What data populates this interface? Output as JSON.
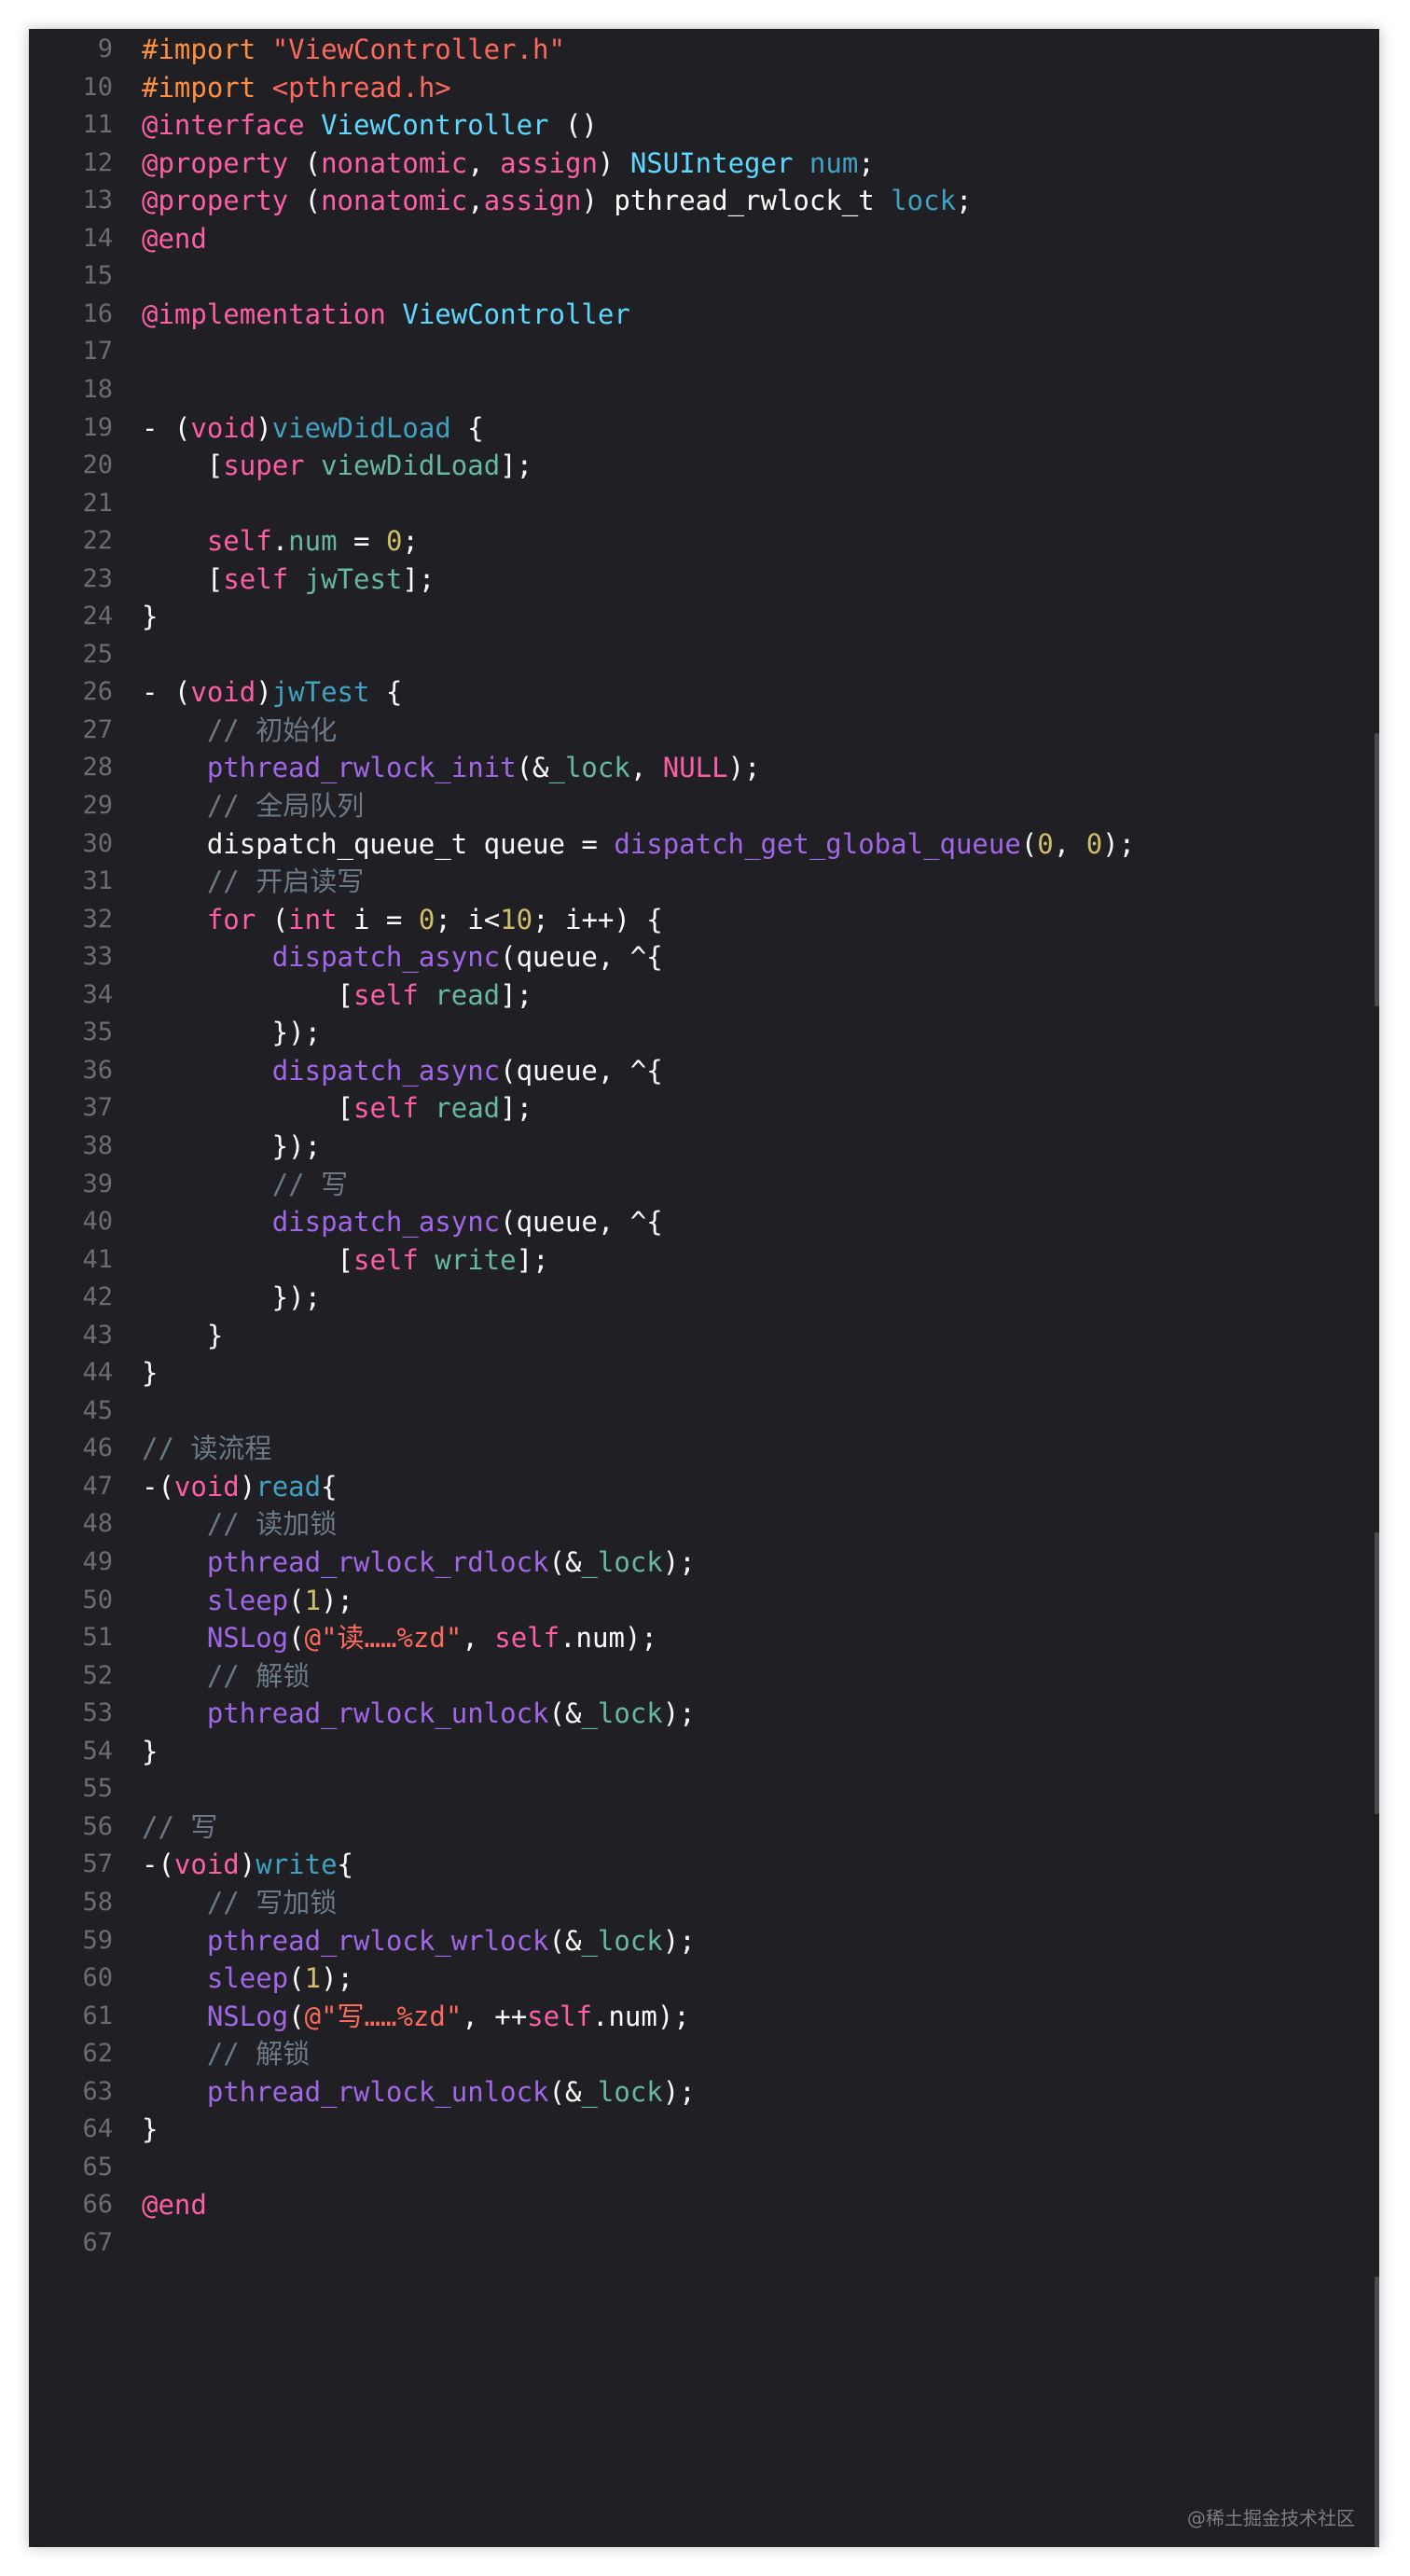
{
  "editor": {
    "watermark": "@稀土掘金技术社区",
    "colors": {
      "background": "#1f1f24",
      "keyword": "#fc5fa3",
      "preprocessor": "#fd8f3f",
      "string": "#fc6a5d",
      "number": "#d0bf69",
      "comment": "#6c7986",
      "type": "#5dd8ff",
      "declaration": "#41a1c0",
      "function": "#a167e6",
      "property": "#67b7a4",
      "plain": "#ffffff",
      "line_number": "#6c6c75"
    },
    "lines": [
      {
        "n": "9",
        "t": [
          [
            "pre",
            "#import "
          ],
          [
            "str",
            "\"ViewController.h\""
          ]
        ]
      },
      {
        "n": "10",
        "t": [
          [
            "pre",
            "#import "
          ],
          [
            "str",
            "<pthread.h>"
          ]
        ]
      },
      {
        "n": "11",
        "t": [
          [
            "kw",
            "@interface "
          ],
          [
            "type",
            "ViewController"
          ],
          [
            "pl",
            " ()"
          ]
        ]
      },
      {
        "n": "12",
        "t": [
          [
            "kw",
            "@property "
          ],
          [
            "pl",
            "("
          ],
          [
            "kw",
            "nonatomic"
          ],
          [
            "pl",
            ", "
          ],
          [
            "kw",
            "assign"
          ],
          [
            "pl",
            ") "
          ],
          [
            "type",
            "NSUInteger"
          ],
          [
            "pl",
            " "
          ],
          [
            "decl",
            "num"
          ],
          [
            "pl",
            ";"
          ]
        ]
      },
      {
        "n": "13",
        "t": [
          [
            "kw",
            "@property "
          ],
          [
            "pl",
            "("
          ],
          [
            "kw",
            "nonatomic"
          ],
          [
            "pl",
            ","
          ],
          [
            "kw",
            "assign"
          ],
          [
            "pl",
            ") pthread_rwlock_t "
          ],
          [
            "decl",
            "lock"
          ],
          [
            "pl",
            ";"
          ]
        ]
      },
      {
        "n": "14",
        "t": [
          [
            "kw",
            "@end"
          ]
        ]
      },
      {
        "n": "15",
        "t": []
      },
      {
        "n": "16",
        "t": [
          [
            "kw",
            "@implementation "
          ],
          [
            "type",
            "ViewController"
          ]
        ]
      },
      {
        "n": "17",
        "t": []
      },
      {
        "n": "18",
        "t": []
      },
      {
        "n": "19",
        "t": [
          [
            "pl",
            "- ("
          ],
          [
            "kw",
            "void"
          ],
          [
            "pl",
            ")"
          ],
          [
            "decl",
            "viewDidLoad"
          ],
          [
            "pl",
            " {"
          ]
        ]
      },
      {
        "n": "20",
        "t": [
          [
            "pl",
            "    ["
          ],
          [
            "kw",
            "super"
          ],
          [
            "pl",
            " "
          ],
          [
            "sym",
            "viewDidLoad"
          ],
          [
            "pl",
            "];"
          ]
        ]
      },
      {
        "n": "21",
        "t": []
      },
      {
        "n": "22",
        "t": [
          [
            "pl",
            "    "
          ],
          [
            "kw",
            "self"
          ],
          [
            "pl",
            "."
          ],
          [
            "prop",
            "num"
          ],
          [
            "pl",
            " = "
          ],
          [
            "num",
            "0"
          ],
          [
            "pl",
            ";"
          ]
        ]
      },
      {
        "n": "23",
        "t": [
          [
            "pl",
            "    ["
          ],
          [
            "kw",
            "self"
          ],
          [
            "pl",
            " "
          ],
          [
            "sym",
            "jwTest"
          ],
          [
            "pl",
            "];"
          ]
        ]
      },
      {
        "n": "24",
        "t": [
          [
            "pl",
            "}"
          ]
        ]
      },
      {
        "n": "25",
        "t": []
      },
      {
        "n": "26",
        "t": [
          [
            "pl",
            "- ("
          ],
          [
            "kw",
            "void"
          ],
          [
            "pl",
            ")"
          ],
          [
            "decl",
            "jwTest"
          ],
          [
            "pl",
            " {"
          ]
        ]
      },
      {
        "n": "27",
        "t": [
          [
            "pl",
            "    "
          ],
          [
            "cmt",
            "// 初始化"
          ]
        ]
      },
      {
        "n": "28",
        "t": [
          [
            "pl",
            "    "
          ],
          [
            "fn",
            "pthread_rwlock_init"
          ],
          [
            "pl",
            "(&"
          ],
          [
            "prop",
            "_lock"
          ],
          [
            "pl",
            ", "
          ],
          [
            "kw",
            "NULL"
          ],
          [
            "pl",
            ");"
          ]
        ]
      },
      {
        "n": "29",
        "t": [
          [
            "pl",
            "    "
          ],
          [
            "cmt",
            "// 全局队列"
          ]
        ]
      },
      {
        "n": "30",
        "t": [
          [
            "pl",
            "    dispatch_queue_t queue = "
          ],
          [
            "fn",
            "dispatch_get_global_queue"
          ],
          [
            "pl",
            "("
          ],
          [
            "num",
            "0"
          ],
          [
            "pl",
            ", "
          ],
          [
            "num",
            "0"
          ],
          [
            "pl",
            ");"
          ]
        ]
      },
      {
        "n": "31",
        "t": [
          [
            "pl",
            "    "
          ],
          [
            "cmt",
            "// 开启读写"
          ]
        ]
      },
      {
        "n": "32",
        "t": [
          [
            "pl",
            "    "
          ],
          [
            "kw",
            "for"
          ],
          [
            "pl",
            " ("
          ],
          [
            "kw",
            "int"
          ],
          [
            "pl",
            " i = "
          ],
          [
            "num",
            "0"
          ],
          [
            "pl",
            "; i<"
          ],
          [
            "num",
            "10"
          ],
          [
            "pl",
            "; i++) {"
          ]
        ]
      },
      {
        "n": "33",
        "t": [
          [
            "pl",
            "        "
          ],
          [
            "fn",
            "dispatch_async"
          ],
          [
            "pl",
            "(queue, ^{"
          ]
        ]
      },
      {
        "n": "34",
        "t": [
          [
            "pl",
            "            ["
          ],
          [
            "kw",
            "self"
          ],
          [
            "pl",
            " "
          ],
          [
            "sym",
            "read"
          ],
          [
            "pl",
            "];"
          ]
        ]
      },
      {
        "n": "35",
        "t": [
          [
            "pl",
            "        });"
          ]
        ]
      },
      {
        "n": "36",
        "t": [
          [
            "pl",
            "        "
          ],
          [
            "fn",
            "dispatch_async"
          ],
          [
            "pl",
            "(queue, ^{"
          ]
        ]
      },
      {
        "n": "37",
        "t": [
          [
            "pl",
            "            ["
          ],
          [
            "kw",
            "self"
          ],
          [
            "pl",
            " "
          ],
          [
            "sym",
            "read"
          ],
          [
            "pl",
            "];"
          ]
        ]
      },
      {
        "n": "38",
        "t": [
          [
            "pl",
            "        });"
          ]
        ]
      },
      {
        "n": "39",
        "t": [
          [
            "pl",
            "        "
          ],
          [
            "cmt",
            "// 写"
          ]
        ]
      },
      {
        "n": "40",
        "t": [
          [
            "pl",
            "        "
          ],
          [
            "fn",
            "dispatch_async"
          ],
          [
            "pl",
            "(queue, ^{"
          ]
        ]
      },
      {
        "n": "41",
        "t": [
          [
            "pl",
            "            ["
          ],
          [
            "kw",
            "self"
          ],
          [
            "pl",
            " "
          ],
          [
            "sym",
            "write"
          ],
          [
            "pl",
            "];"
          ]
        ]
      },
      {
        "n": "42",
        "t": [
          [
            "pl",
            "        });"
          ]
        ]
      },
      {
        "n": "43",
        "t": [
          [
            "pl",
            "    }"
          ]
        ]
      },
      {
        "n": "44",
        "t": [
          [
            "pl",
            "}"
          ]
        ]
      },
      {
        "n": "45",
        "t": []
      },
      {
        "n": "46",
        "t": [
          [
            "cmt",
            "// 读流程"
          ]
        ]
      },
      {
        "n": "47",
        "t": [
          [
            "pl",
            "-("
          ],
          [
            "kw",
            "void"
          ],
          [
            "pl",
            ")"
          ],
          [
            "decl",
            "read"
          ],
          [
            "pl",
            "{"
          ]
        ]
      },
      {
        "n": "48",
        "t": [
          [
            "pl",
            "    "
          ],
          [
            "cmt",
            "// 读加锁"
          ]
        ]
      },
      {
        "n": "49",
        "t": [
          [
            "pl",
            "    "
          ],
          [
            "fn",
            "pthread_rwlock_rdlock"
          ],
          [
            "pl",
            "(&"
          ],
          [
            "prop",
            "_lock"
          ],
          [
            "pl",
            ");"
          ]
        ]
      },
      {
        "n": "50",
        "t": [
          [
            "pl",
            "    "
          ],
          [
            "fn",
            "sleep"
          ],
          [
            "pl",
            "("
          ],
          [
            "num",
            "1"
          ],
          [
            "pl",
            ");"
          ]
        ]
      },
      {
        "n": "51",
        "t": [
          [
            "pl",
            "    "
          ],
          [
            "fn",
            "NSLog"
          ],
          [
            "pl",
            "("
          ],
          [
            "str",
            "@\"读……%zd\""
          ],
          [
            "pl",
            ", "
          ],
          [
            "kw",
            "self"
          ],
          [
            "pl",
            ".num);"
          ]
        ]
      },
      {
        "n": "52",
        "t": [
          [
            "pl",
            "    "
          ],
          [
            "cmt",
            "// 解锁"
          ]
        ]
      },
      {
        "n": "53",
        "t": [
          [
            "pl",
            "    "
          ],
          [
            "fn",
            "pthread_rwlock_unlock"
          ],
          [
            "pl",
            "(&"
          ],
          [
            "prop",
            "_lock"
          ],
          [
            "pl",
            ");"
          ]
        ]
      },
      {
        "n": "54",
        "t": [
          [
            "pl",
            "}"
          ]
        ]
      },
      {
        "n": "55",
        "t": []
      },
      {
        "n": "56",
        "t": [
          [
            "cmt",
            "// 写"
          ]
        ]
      },
      {
        "n": "57",
        "t": [
          [
            "pl",
            "-("
          ],
          [
            "kw",
            "void"
          ],
          [
            "pl",
            ")"
          ],
          [
            "decl",
            "write"
          ],
          [
            "pl",
            "{"
          ]
        ]
      },
      {
        "n": "58",
        "t": [
          [
            "pl",
            "    "
          ],
          [
            "cmt",
            "// 写加锁"
          ]
        ]
      },
      {
        "n": "59",
        "t": [
          [
            "pl",
            "    "
          ],
          [
            "fn",
            "pthread_rwlock_wrlock"
          ],
          [
            "pl",
            "(&"
          ],
          [
            "prop",
            "_lock"
          ],
          [
            "pl",
            ");"
          ]
        ]
      },
      {
        "n": "60",
        "t": [
          [
            "pl",
            "    "
          ],
          [
            "fn",
            "sleep"
          ],
          [
            "pl",
            "("
          ],
          [
            "num",
            "1"
          ],
          [
            "pl",
            ");"
          ]
        ]
      },
      {
        "n": "61",
        "t": [
          [
            "pl",
            "    "
          ],
          [
            "fn",
            "NSLog"
          ],
          [
            "pl",
            "("
          ],
          [
            "str",
            "@\"写……%zd\""
          ],
          [
            "pl",
            ", ++"
          ],
          [
            "kw",
            "self"
          ],
          [
            "pl",
            ".num);"
          ]
        ]
      },
      {
        "n": "62",
        "t": [
          [
            "pl",
            "    "
          ],
          [
            "cmt",
            "// 解锁"
          ]
        ]
      },
      {
        "n": "63",
        "t": [
          [
            "pl",
            "    "
          ],
          [
            "fn",
            "pthread_rwlock_unlock"
          ],
          [
            "pl",
            "(&"
          ],
          [
            "prop",
            "_lock"
          ],
          [
            "pl",
            ");"
          ]
        ]
      },
      {
        "n": "64",
        "t": [
          [
            "pl",
            "}"
          ]
        ]
      },
      {
        "n": "65",
        "t": []
      },
      {
        "n": "66",
        "t": [
          [
            "kw",
            "@end"
          ]
        ]
      },
      {
        "n": "67",
        "t": []
      }
    ]
  }
}
